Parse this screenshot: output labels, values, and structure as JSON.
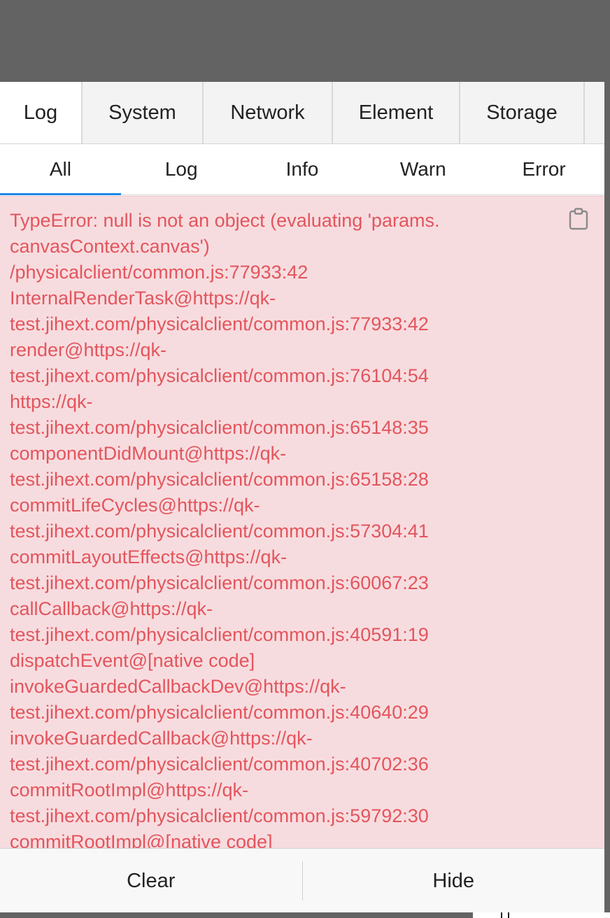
{
  "tabs": [
    {
      "label": "Log"
    },
    {
      "label": "System"
    },
    {
      "label": "Network"
    },
    {
      "label": "Element"
    },
    {
      "label": "Storage"
    },
    {
      "label": ""
    }
  ],
  "active_tab": "Log",
  "filters": [
    {
      "label": "All"
    },
    {
      "label": "Log"
    },
    {
      "label": "Info"
    },
    {
      "label": "Warn"
    },
    {
      "label": "Error"
    }
  ],
  "active_filter": "All",
  "log": {
    "level": "error",
    "text": "TypeError: null is not an object (evaluating 'params.\ncanvasContext.canvas')\n/physicalclient/common.js:77933:42\nInternalRenderTask@https://qk-\ntest.jihext.com/physicalclient/common.js:77933:42\nrender@https://qk-\ntest.jihext.com/physicalclient/common.js:76104:54\nhttps://qk-\ntest.jihext.com/physicalclient/common.js:65148:35\ncomponentDidMount@https://qk-\ntest.jihext.com/physicalclient/common.js:65158:28\ncommitLifeCycles@https://qk-\ntest.jihext.com/physicalclient/common.js:57304:41\ncommitLayoutEffects@https://qk-\ntest.jihext.com/physicalclient/common.js:60067:23\ncallCallback@https://qk-\ntest.jihext.com/physicalclient/common.js:40591:19\ndispatchEvent@[native code]\ninvokeGuardedCallbackDev@https://qk-\ntest.jihext.com/physicalclient/common.js:40640:29\ninvokeGuardedCallback@https://qk-\ntest.jihext.com/physicalclient/common.js:40702:36\ncommitRootImpl@https://qk-\ntest.jihext.com/physicalclient/common.js:59792:30\ncommitRootImpl@[native code]",
    "copy_icon": "clipboard-icon"
  },
  "footer": {
    "clear_label": "Clear",
    "hide_label": "Hide"
  },
  "colors": {
    "error_text": "#e3555d",
    "error_background": "#f7dcdf",
    "active_underline": "#1e88e5",
    "backdrop": "#636363"
  }
}
